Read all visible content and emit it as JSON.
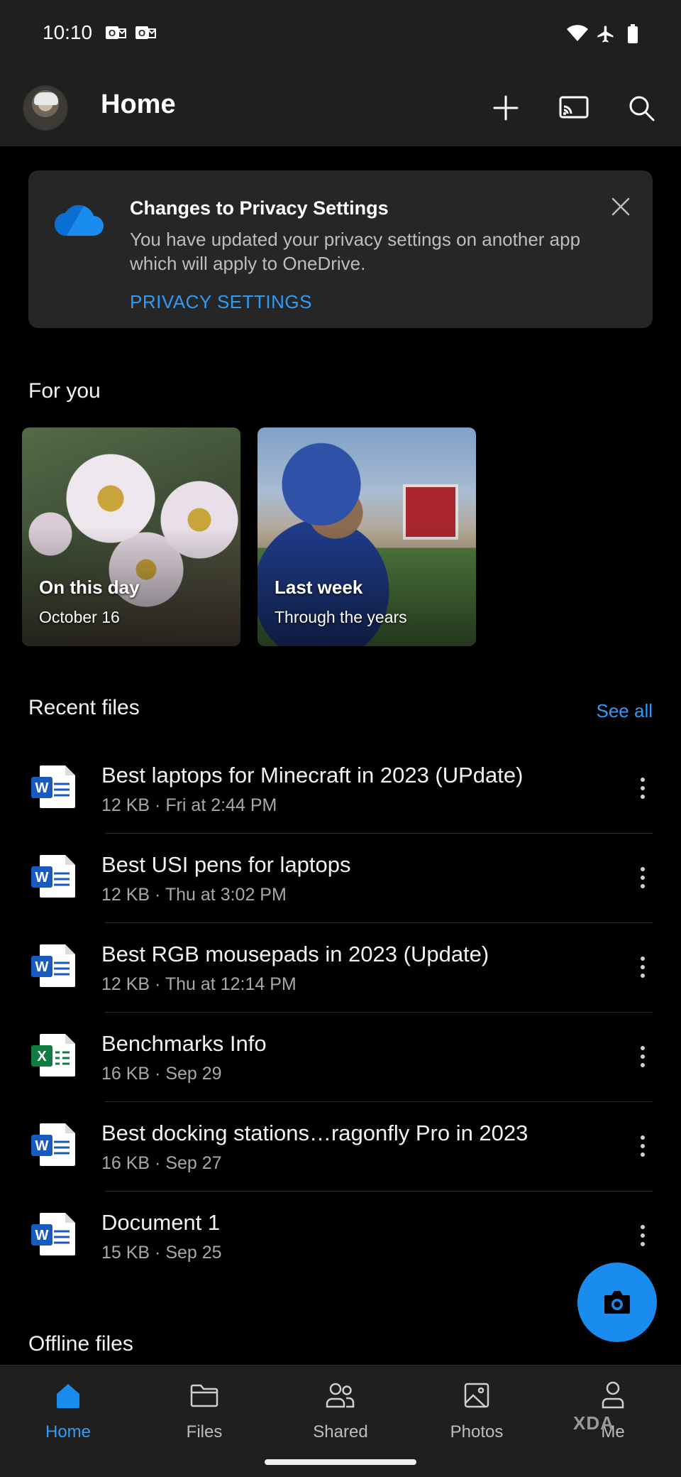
{
  "status_bar": {
    "time": "10:10"
  },
  "app_bar": {
    "title": "Home"
  },
  "privacy_card": {
    "title": "Changes to Privacy Settings",
    "body": "You have updated your privacy settings on another app which will apply to OneDrive.",
    "link": "PRIVACY SETTINGS"
  },
  "for_you": {
    "title": "For you",
    "tiles": [
      {
        "title": "On this day",
        "subtitle": "October 16"
      },
      {
        "title": "Last week",
        "subtitle": "Through the years"
      }
    ]
  },
  "recent_files": {
    "title": "Recent files",
    "see_all": "See all",
    "items": [
      {
        "name": "Best laptops for Minecraft in 2023 (UPdate)",
        "meta": "12 KB · Fri at 2:44 PM",
        "type": "word"
      },
      {
        "name": "Best USI pens for laptops",
        "meta": "12 KB · Thu at 3:02 PM",
        "type": "word"
      },
      {
        "name": "Best RGB mousepads in 2023 (Update)",
        "meta": "12 KB · Thu at 12:14 PM",
        "type": "word"
      },
      {
        "name": "Benchmarks Info",
        "meta": "16 KB · Sep 29",
        "type": "excel"
      },
      {
        "name": "Best docking stations…ragonfly Pro in 2023",
        "meta": "16 KB · Sep 27",
        "type": "word"
      },
      {
        "name": "Document 1",
        "meta": "15 KB · Sep 25",
        "type": "word"
      }
    ]
  },
  "offline_files": {
    "title": "Offline files"
  },
  "bottom_nav": {
    "items": [
      {
        "label": "Home",
        "icon": "home-icon",
        "active": true
      },
      {
        "label": "Files",
        "icon": "folder-icon",
        "active": false
      },
      {
        "label": "Shared",
        "icon": "people-icon",
        "active": false
      },
      {
        "label": "Photos",
        "icon": "image-icon",
        "active": false
      },
      {
        "label": "Me",
        "icon": "person-icon",
        "active": false
      }
    ],
    "watermark": "XDA"
  },
  "colors": {
    "accent": "#2f9bf5",
    "fab": "#1a8cf0",
    "surface": "#1f1f1f",
    "card": "#262626",
    "word_blue": "#185abd",
    "excel_green": "#107c41"
  }
}
